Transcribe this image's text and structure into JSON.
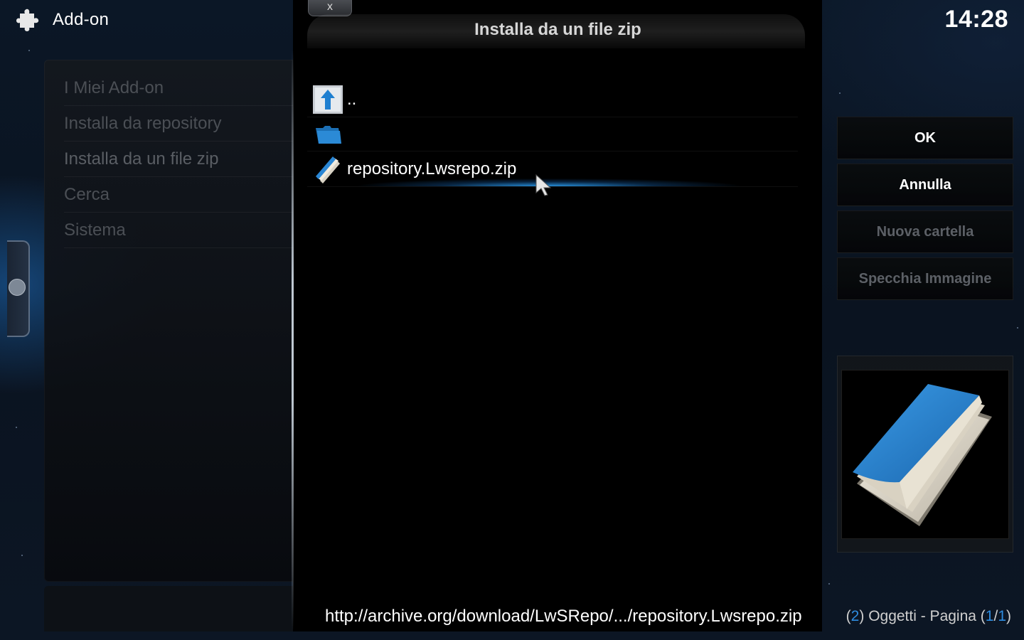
{
  "header": {
    "title": "Add-on",
    "icon": "puzzle-icon",
    "clock": "14:28"
  },
  "side_menu": {
    "items": [
      {
        "label": "I Miei Add-on"
      },
      {
        "label": "Installa da repository"
      },
      {
        "label": "Installa da un file zip"
      },
      {
        "label": "Cerca"
      },
      {
        "label": "Sistema"
      }
    ]
  },
  "dialog": {
    "close_label": "x",
    "title": "Installa da un file zip",
    "files": [
      {
        "label": "..",
        "icon": "up-arrow-icon"
      },
      {
        "label": "",
        "icon": "folder-icon"
      },
      {
        "label": "repository.Lwsrepo.zip",
        "icon": "zip-file-icon",
        "selected": true
      }
    ],
    "status_path": "http://archive.org/download/LwSRepo/.../repository.Lwsrepo.zip"
  },
  "buttons": {
    "ok": "OK",
    "cancel": "Annulla",
    "new_folder": "Nuova cartella",
    "mirror_image": "Specchia Immagine"
  },
  "page_info": {
    "count": "2",
    "items_text": "Oggetti - Pagina",
    "page": "1",
    "pages": "1"
  },
  "colors": {
    "accent": "#2e8ce0",
    "disabled_text": "#5c6066"
  }
}
